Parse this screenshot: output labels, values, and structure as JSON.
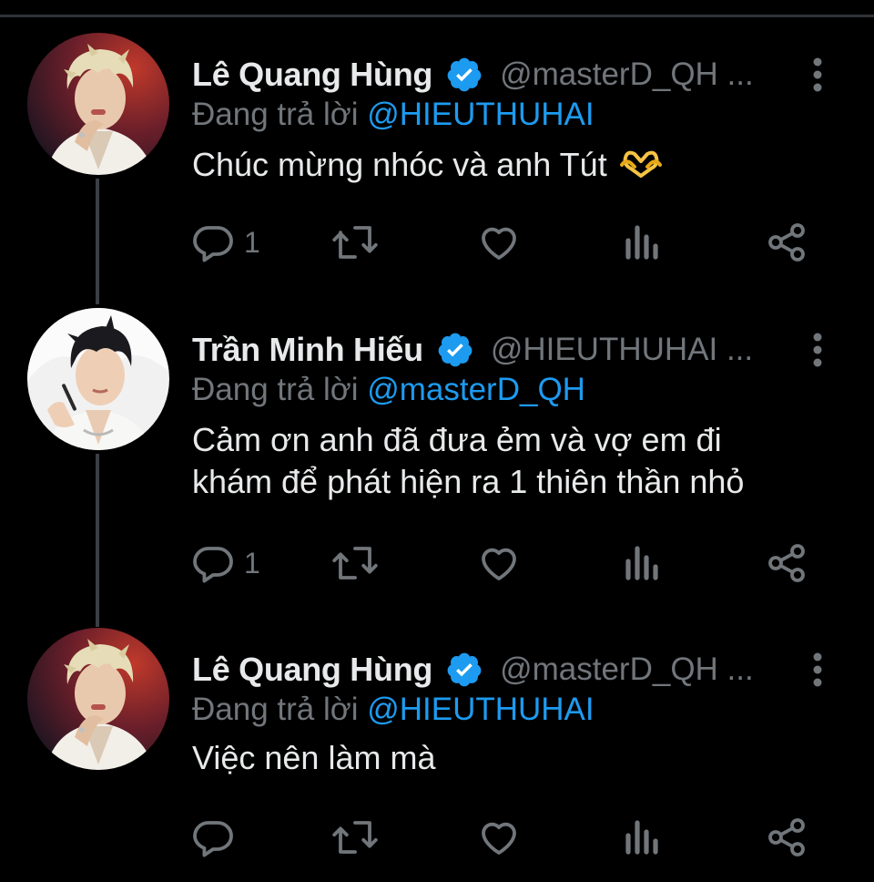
{
  "theme": {
    "background": "#000000",
    "text": "#e7e9ea",
    "muted": "#71767b",
    "accent": "#1d9bf0",
    "thread_line": "#3a3f44"
  },
  "tweets": [
    {
      "name": "Lê Quang Hùng",
      "handle": "@masterD_QH ...",
      "replying_prefix": "Đang trả lời",
      "replying_to": "@HIEUTHUHAI",
      "text": "Chúc mừng nhóc và anh Tút",
      "emoji": "heart-hands-icon",
      "reply_count": "1",
      "avatar": "avatar-le-quang-hung"
    },
    {
      "name": "Trần Minh Hiếu",
      "handle": "@HIEUTHUHAI ...",
      "replying_prefix": "Đang trả lời",
      "replying_to": "@masterD_QH",
      "text_line1": "Cảm ơn anh đã đưa ẻm và vợ em đi",
      "text_line2": "khám để phát hiện ra 1 thiên thần nhỏ",
      "reply_count": "1",
      "avatar": "avatar-tran-minh-hieu"
    },
    {
      "name": "Lê Quang Hùng",
      "handle": "@masterD_QH ...",
      "replying_prefix": "Đang trả lời",
      "replying_to": "@HIEUTHUHAI",
      "text": "Việc nên làm mà",
      "reply_count": "",
      "avatar": "avatar-le-quang-hung"
    }
  ],
  "icons": {
    "verified": "verified-badge-icon",
    "more": "more-vertical-icon",
    "reply": "reply-icon",
    "retweet": "retweet-icon",
    "like": "like-icon",
    "views": "views-icon",
    "share": "share-icon"
  }
}
